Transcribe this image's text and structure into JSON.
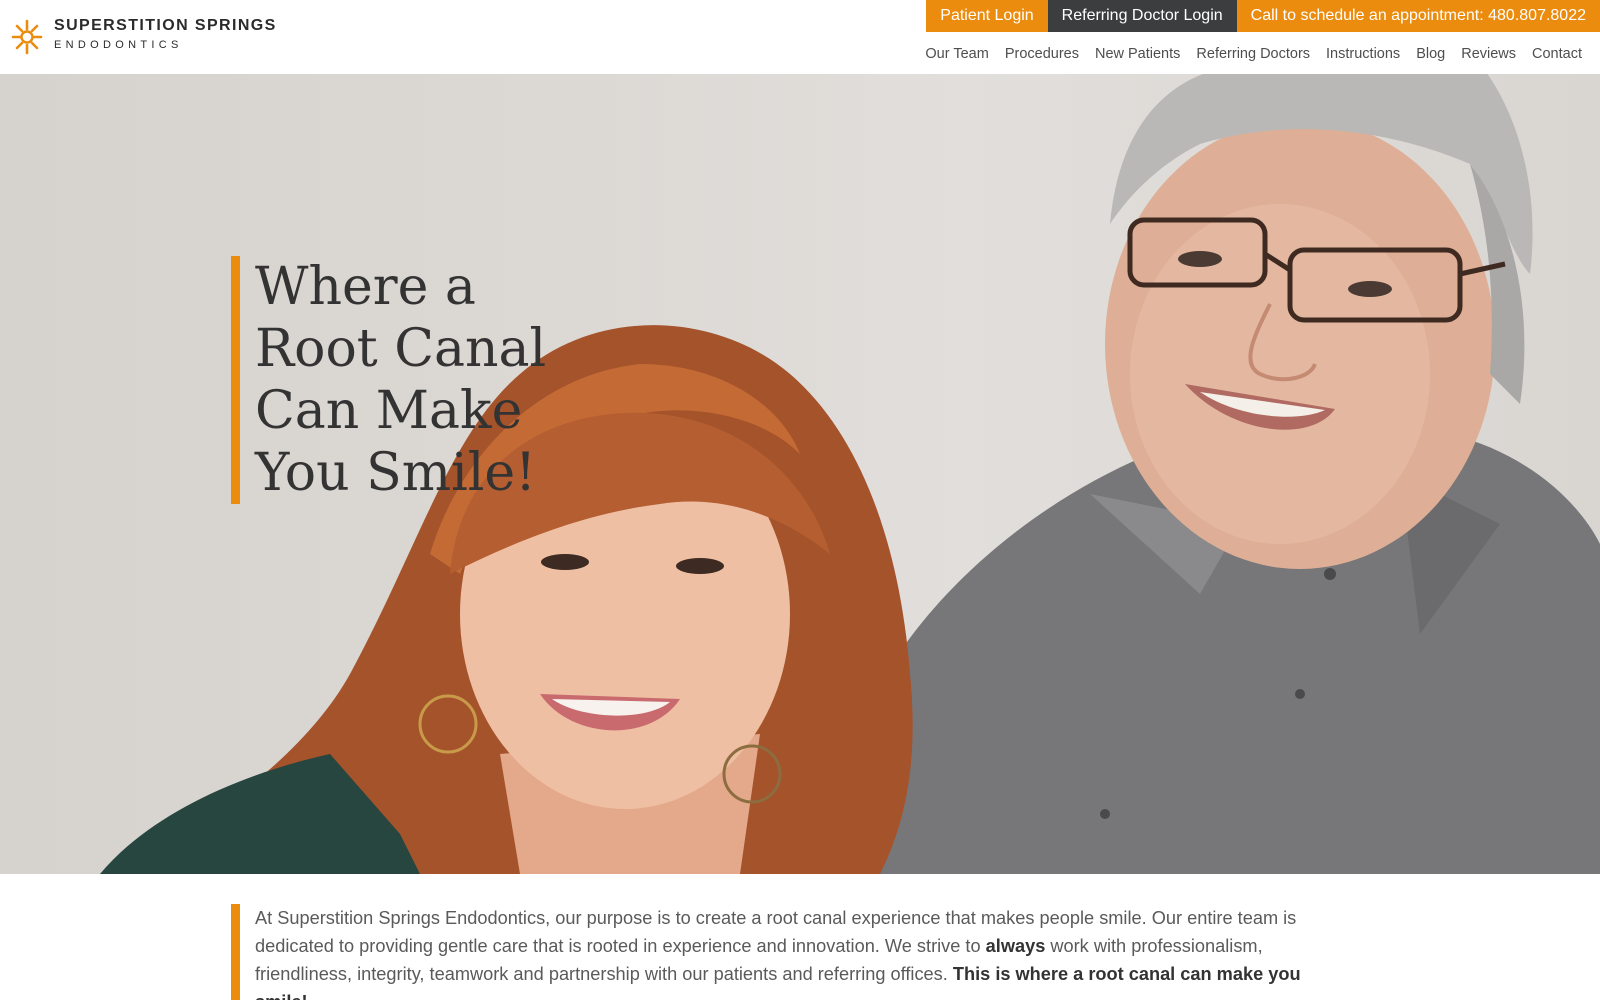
{
  "brand": {
    "name": "SUPERSTITION SPRINGS",
    "sub": "ENDODONTICS",
    "logo_icon": "sunburst-tooth-icon",
    "accent_color": "#ec8c0e",
    "dark_color": "#3b3d3e"
  },
  "utility_bar": {
    "patient_login": "Patient Login",
    "referring_doctor_login": "Referring Doctor Login",
    "call_text": "Call to schedule an appointment: 480.807.8022"
  },
  "nav": {
    "items": [
      "Our Team",
      "Procedures",
      "New Patients",
      "Referring Doctors",
      "Instructions",
      "Blog",
      "Reviews",
      "Contact"
    ]
  },
  "hero": {
    "title_lines": [
      "Where a",
      "Root Canal",
      "Can Make",
      "You Smile!"
    ],
    "image_alt": "smiling-couple-photo"
  },
  "intro": {
    "part1": "At Superstition Springs Endodontics, our purpose is to create a root canal experience that makes people smile. Our entire team is dedicated to providing gentle care that is rooted in experience and innovation. We strive to ",
    "bold1": "always",
    "part2": " work with professionalism, friendliness, integrity, teamwork and partnership with our patients and referring offices. ",
    "bold2": "This is where a root canal can make you smile!"
  }
}
